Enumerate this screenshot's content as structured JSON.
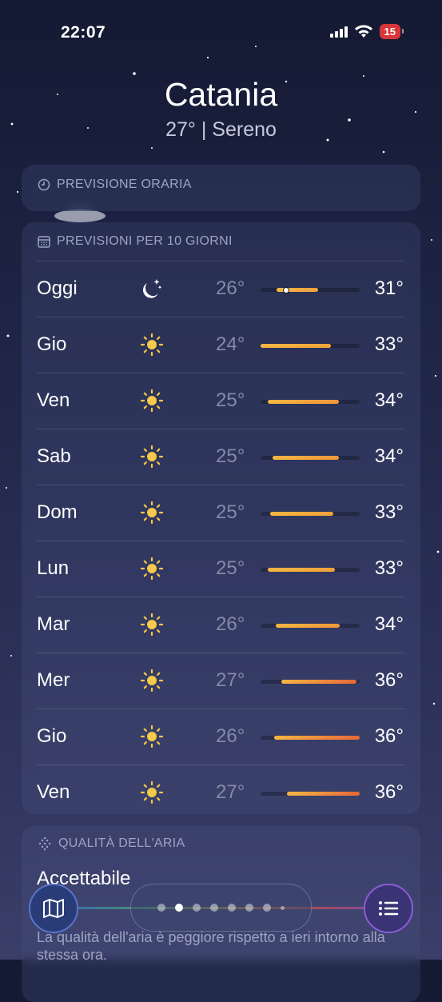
{
  "status": {
    "time": "22:07",
    "battery": "15"
  },
  "header": {
    "city": "Catania",
    "condition": "27°  |  Sereno"
  },
  "hourly": {
    "title": "PREVISIONE ORARIA",
    "icon": "clock-icon"
  },
  "daily": {
    "title": "PREVISIONI PER 10 GIORNI",
    "icon": "calendar-icon",
    "rows": [
      {
        "day": "Oggi",
        "icon": "moon-stars-icon",
        "lo": "26°",
        "hi": "31°",
        "bar": [
          0.16,
          0.58
        ],
        "current": 0.25,
        "color": "#f0a040"
      },
      {
        "day": "Gio",
        "icon": "sun-icon",
        "lo": "24°",
        "hi": "33°",
        "bar": [
          0.0,
          0.71
        ],
        "color": "#f0a43a"
      },
      {
        "day": "Ven",
        "icon": "sun-icon",
        "lo": "25°",
        "hi": "34°",
        "bar": [
          0.07,
          0.79
        ],
        "color": "#ef963a"
      },
      {
        "day": "Sab",
        "icon": "sun-icon",
        "lo": "25°",
        "hi": "34°",
        "bar": [
          0.12,
          0.79
        ],
        "color": "#ef963a"
      },
      {
        "day": "Dom",
        "icon": "sun-icon",
        "lo": "25°",
        "hi": "33°",
        "bar": [
          0.1,
          0.73
        ],
        "color": "#f0a03a"
      },
      {
        "day": "Lun",
        "icon": "sun-icon",
        "lo": "25°",
        "hi": "33°",
        "bar": [
          0.07,
          0.75
        ],
        "color": "#f0a03a"
      },
      {
        "day": "Mar",
        "icon": "sun-icon",
        "lo": "26°",
        "hi": "34°",
        "bar": [
          0.15,
          0.8
        ],
        "color": "#ef963a"
      },
      {
        "day": "Mer",
        "icon": "sun-icon",
        "lo": "27°",
        "hi": "36°",
        "bar": [
          0.21,
          0.97
        ],
        "color": "#e8673a"
      },
      {
        "day": "Gio",
        "icon": "sun-icon",
        "lo": "26°",
        "hi": "36°",
        "bar": [
          0.14,
          1.0
        ],
        "color": "#e8673a"
      },
      {
        "day": "Ven",
        "icon": "sun-icon",
        "lo": "27°",
        "hi": "36°",
        "bar": [
          0.27,
          1.0
        ],
        "color": "#e8673a"
      }
    ]
  },
  "air_quality": {
    "title": "QUALITÀ DELL'ARIA",
    "icon": "air-quality-icon",
    "value": "Accettabile",
    "description": "La qualità dell'aria è peggiore rispetto a ieri intorno alla stessa ora."
  },
  "bottom": {
    "map_icon": "map-icon",
    "list_icon": "list-icon",
    "page_count": 8,
    "active_page": 1
  }
}
